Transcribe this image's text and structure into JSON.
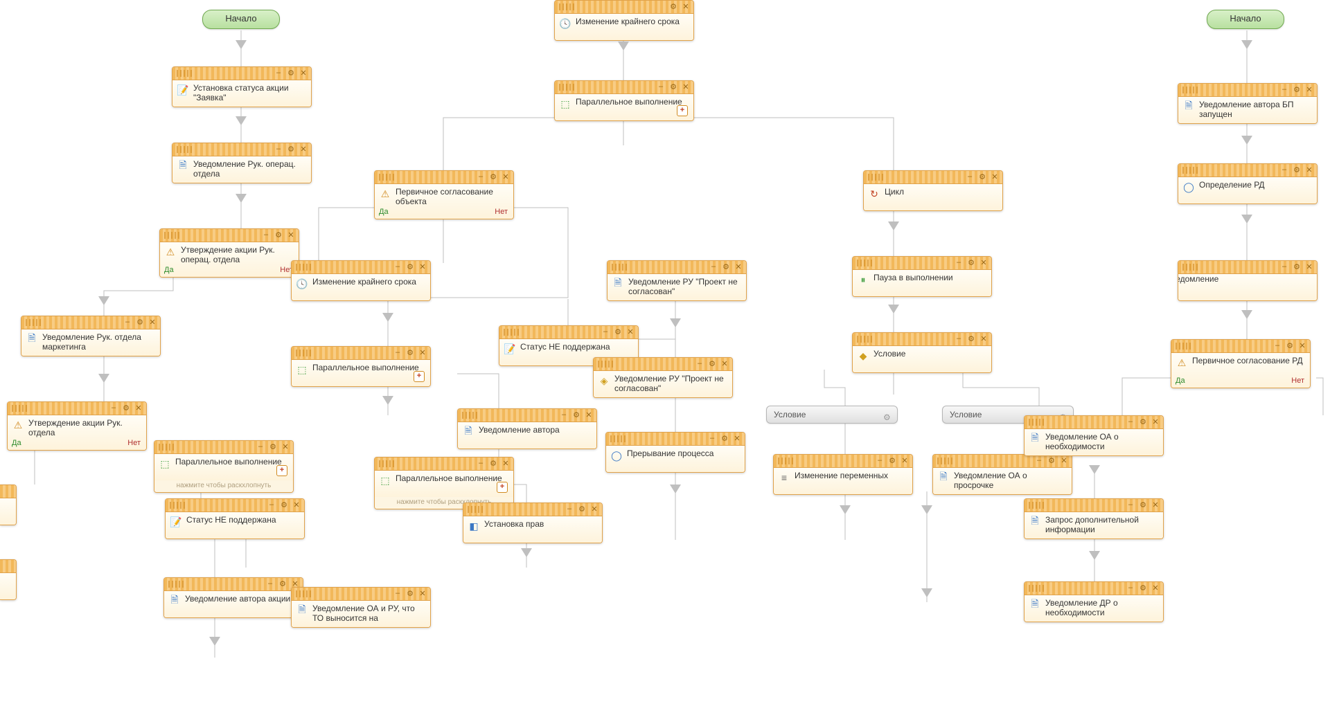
{
  "labels": {
    "start": "Начало",
    "yes": "Да",
    "no": "Нет",
    "expand_hint": "нажмите чтобы раскхлопнуть",
    "condition": "Условие"
  },
  "nodes": {
    "n1": "Установка статуса акции \"Заявка\"",
    "n2": "Уведомление Рук. операц. отдела",
    "n3": "Утверждение акции Рук. операц. отдела",
    "n4": "Уведомление Рук. отдела маркетинга",
    "n5": "Утверждение акции Рук. отдела",
    "n6": "Параллельное выполнение",
    "n7": "Статус НЕ поддержана",
    "n8": "Уведомление автора акции",
    "n9": "Изменение крайнего срока",
    "n10": "Параллельное выполнение",
    "n11": "Уведомление автора",
    "n12": "Параллельное выполнение",
    "n13": "Уведомление ОА и РУ, что ТО выносится на",
    "n14": "Изменение крайнего срока",
    "n15": "Параллельное выполнение",
    "n16": "Первичное согласование объекта",
    "n17": "Статус НЕ поддержана",
    "n18": "Уведомление РУ \"Проект не согласован\"",
    "n19": "Уведомление РУ \"Проект не согласован\"",
    "n20": "Прерывание процесса",
    "n21": "Установка прав",
    "n22": "Цикл",
    "n23": "Пауза в выполнении",
    "n24": "Условие",
    "n25": "Изменение переменных",
    "n26": "Уведомление ОА о просрочке",
    "n27": "Уведомление автора БП запущен",
    "n28": "Определение РД",
    "n29": "Уведомление РД",
    "n30": "Первичное согласование РД",
    "n31": "Уведомление ОА о необходимости",
    "n32": "Запрос дополнительной информации",
    "n33": "Уведомление ДР о необходимости"
  }
}
